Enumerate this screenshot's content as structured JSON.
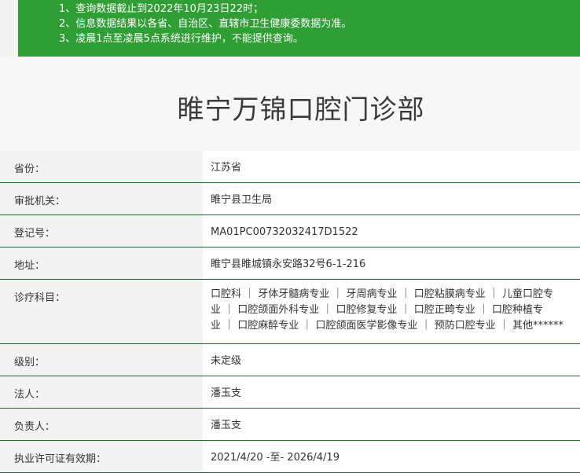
{
  "notice": {
    "lines": [
      "1、查询数据截止到2022年10月23日22时；",
      "2、信息数据结果以各省、自治区、直辖市卫生健康委数据为准。",
      "3、凌晨1点至凌晨5点系统进行维护，不能提供查询。"
    ]
  },
  "title": "睢宁万锦口腔门诊部",
  "fields": [
    {
      "label": "省份：",
      "value": "江苏省"
    },
    {
      "label": "审批机关：",
      "value": "睢宁县卫生局"
    },
    {
      "label": "登记号：",
      "value": "MA01PC00732032417D1522"
    },
    {
      "label": "地址：",
      "value": "睢宁县睢城镇永安路32号6-1-216"
    },
    {
      "label": "诊疗科目：",
      "lines": [
        "口腔科 ｜ 牙体牙髓病专业 ｜ 牙周病专业 ｜ 口腔粘膜病专业 ｜ 儿童口腔专",
        "业 ｜ 口腔颌面外科专业 ｜ 口腔修复专业 ｜ 口腔正畸专业 ｜ 口腔种植专",
        "业 ｜ 口腔麻醉专业 ｜ 口腔颌面医学影像专业 ｜ 预防口腔专业 ｜ 其他******"
      ]
    },
    {
      "label": "级别：",
      "value": "未定级"
    },
    {
      "label": "法人：",
      "value": "潘玉支"
    },
    {
      "label": "负责人：",
      "value": "潘玉支"
    },
    {
      "label": "执业许可证有效期：",
      "value": "2021/4/20 -至- 2026/4/19"
    }
  ]
}
